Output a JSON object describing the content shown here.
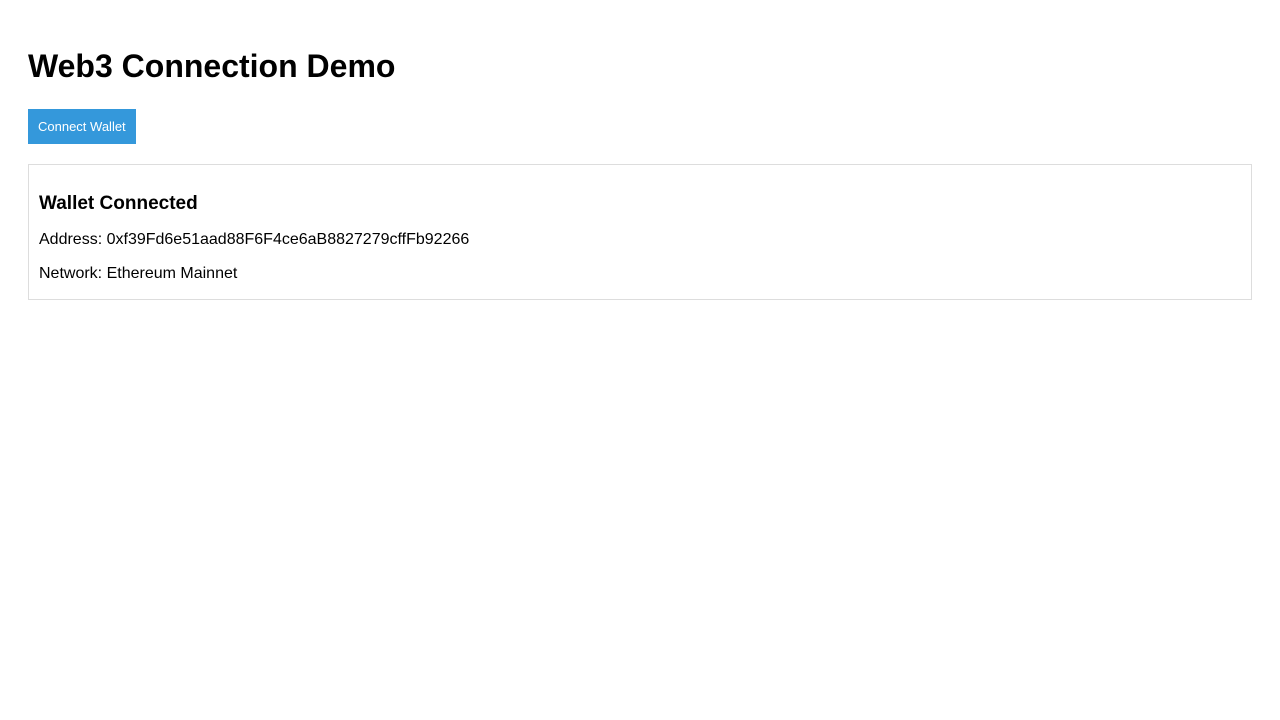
{
  "page": {
    "title": "Web3 Connection Demo"
  },
  "toolbar": {
    "connect_label": "Connect Wallet"
  },
  "wallet": {
    "heading": "Wallet Connected",
    "address_label": "Address:",
    "address_value": "0xf39Fd6e51aad88F6F4ce6aB8827279cffFb92266",
    "network_label": "Network:",
    "network_value": "Ethereum Mainnet"
  },
  "colors": {
    "accent": "#3498db",
    "panel_border": "#dddddd",
    "text": "#000000",
    "background": "#ffffff"
  }
}
